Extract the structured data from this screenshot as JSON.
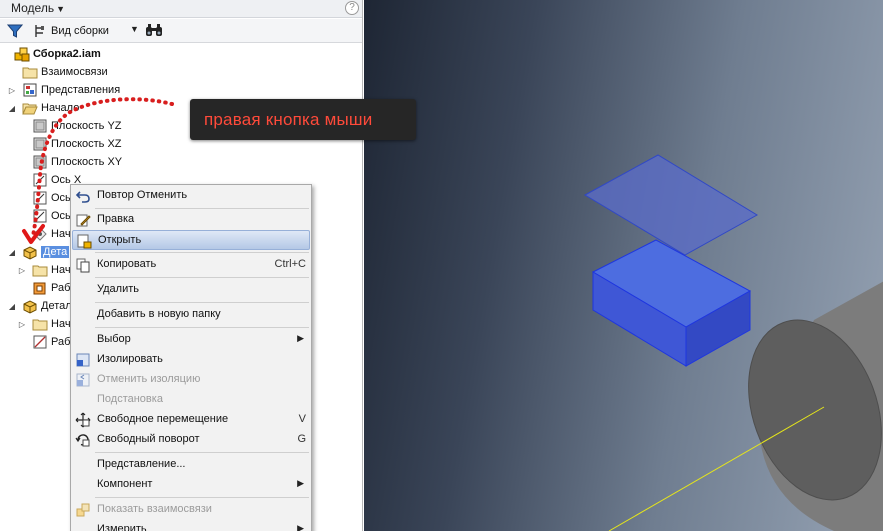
{
  "panel": {
    "title": "Модель",
    "help": "?",
    "view_label": "Вид сборки"
  },
  "tree": [
    {
      "label": "Сборка2.iam",
      "icon": "assembly-icon"
    },
    {
      "label": "Взаимосвязи",
      "icon": "folder-icon"
    },
    {
      "label": "Представления",
      "icon": "representations-icon"
    },
    {
      "label": "Начало",
      "icon": "folder-open-icon"
    },
    {
      "label": "Плоскость YZ",
      "icon": "plane-icon"
    },
    {
      "label": "Плоскость XZ",
      "icon": "plane-icon"
    },
    {
      "label": "Плоскость XY",
      "icon": "plane-icon"
    },
    {
      "label": "Ось X",
      "icon": "axis-icon"
    },
    {
      "label": "Ось",
      "icon": "axis-icon"
    },
    {
      "label": "Ось",
      "icon": "axis-icon"
    },
    {
      "label": "Нача",
      "icon": "point-icon"
    },
    {
      "label": "Дета",
      "icon": "part-icon"
    },
    {
      "label": "Нача",
      "icon": "folder-icon"
    },
    {
      "label": "Раб",
      "icon": "workpiece-icon"
    },
    {
      "label": "Деталь",
      "icon": "part-icon"
    },
    {
      "label": "Начало",
      "icon": "folder-icon"
    },
    {
      "label": "Раб",
      "icon": "sketch-icon"
    }
  ],
  "callout": {
    "text": "правая кнопка мыши",
    "color": "#ff4a3a"
  },
  "menu": {
    "items": [
      {
        "label": "Повтор Отменить",
        "icon": "undo-icon"
      },
      {
        "label": "Правка",
        "icon": "edit-icon"
      },
      {
        "label": "Открыть",
        "icon": "open-icon",
        "highlighted": true
      },
      {
        "label": "Копировать",
        "icon": "copy-icon",
        "shortcut": "Ctrl+C"
      },
      {
        "label": "Удалить"
      },
      {
        "label": "Добавить в новую папку"
      },
      {
        "label": "Выбор",
        "submenu": true
      },
      {
        "label": "Изолировать",
        "icon": "isolate-icon"
      },
      {
        "label": "Отменить изоляцию",
        "icon": "undo-isolate-icon",
        "disabled": true
      },
      {
        "label": "Подстановка",
        "disabled": true
      },
      {
        "label": "Свободное перемещение",
        "icon": "move-icon",
        "shortcut": "V"
      },
      {
        "label": "Свободный поворот",
        "icon": "rotate-icon",
        "shortcut": "G"
      },
      {
        "label": "Представление..."
      },
      {
        "label": "Компонент",
        "submenu": true
      },
      {
        "label": "Показать взаимосвязи",
        "icon": "relations-icon",
        "disabled": true
      },
      {
        "label": "Измерить",
        "submenu": true
      }
    ]
  },
  "colors": {
    "selection": "#5a8fe0",
    "part_blue": "#4a66d6",
    "menu_highlight": "#b4c8e6"
  }
}
